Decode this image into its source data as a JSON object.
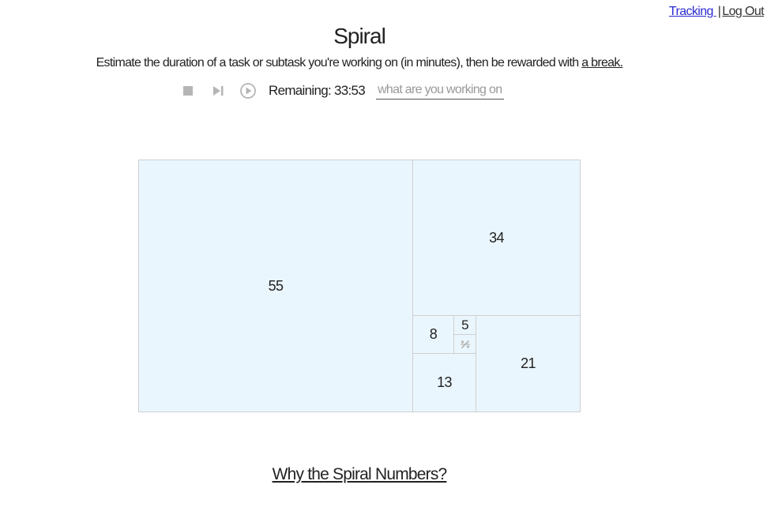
{
  "nav": {
    "tracking_label": "Tracking ",
    "separator": "|",
    "logout_label": "Log Out"
  },
  "header": {
    "title": "Spiral",
    "subtitle_text": "Estimate the duration of a task or subtask you're working on (in minutes), then be rewarded with ",
    "subtitle_link": "a break."
  },
  "timer": {
    "remaining": "Remaining: 33:53",
    "task_placeholder": "what are you working on?",
    "icons": [
      "stop-icon",
      "skip-next-icon",
      "play-circle-icon"
    ]
  },
  "spiral": {
    "cells": [
      {
        "label": "55"
      },
      {
        "label": "34"
      },
      {
        "label": "21"
      },
      {
        "label": "13"
      },
      {
        "label": "8"
      },
      {
        "label": "5"
      }
    ],
    "custom_icon": "percent-custom-icon"
  },
  "footer": {
    "why_link": "Why the Spiral Numbers?"
  },
  "colors": {
    "cell_bg": "#eaf6fd",
    "cell_border": "#cfcfcf",
    "link_blue": "#2a2ad0",
    "icon_gray": "#b5b5b5"
  }
}
